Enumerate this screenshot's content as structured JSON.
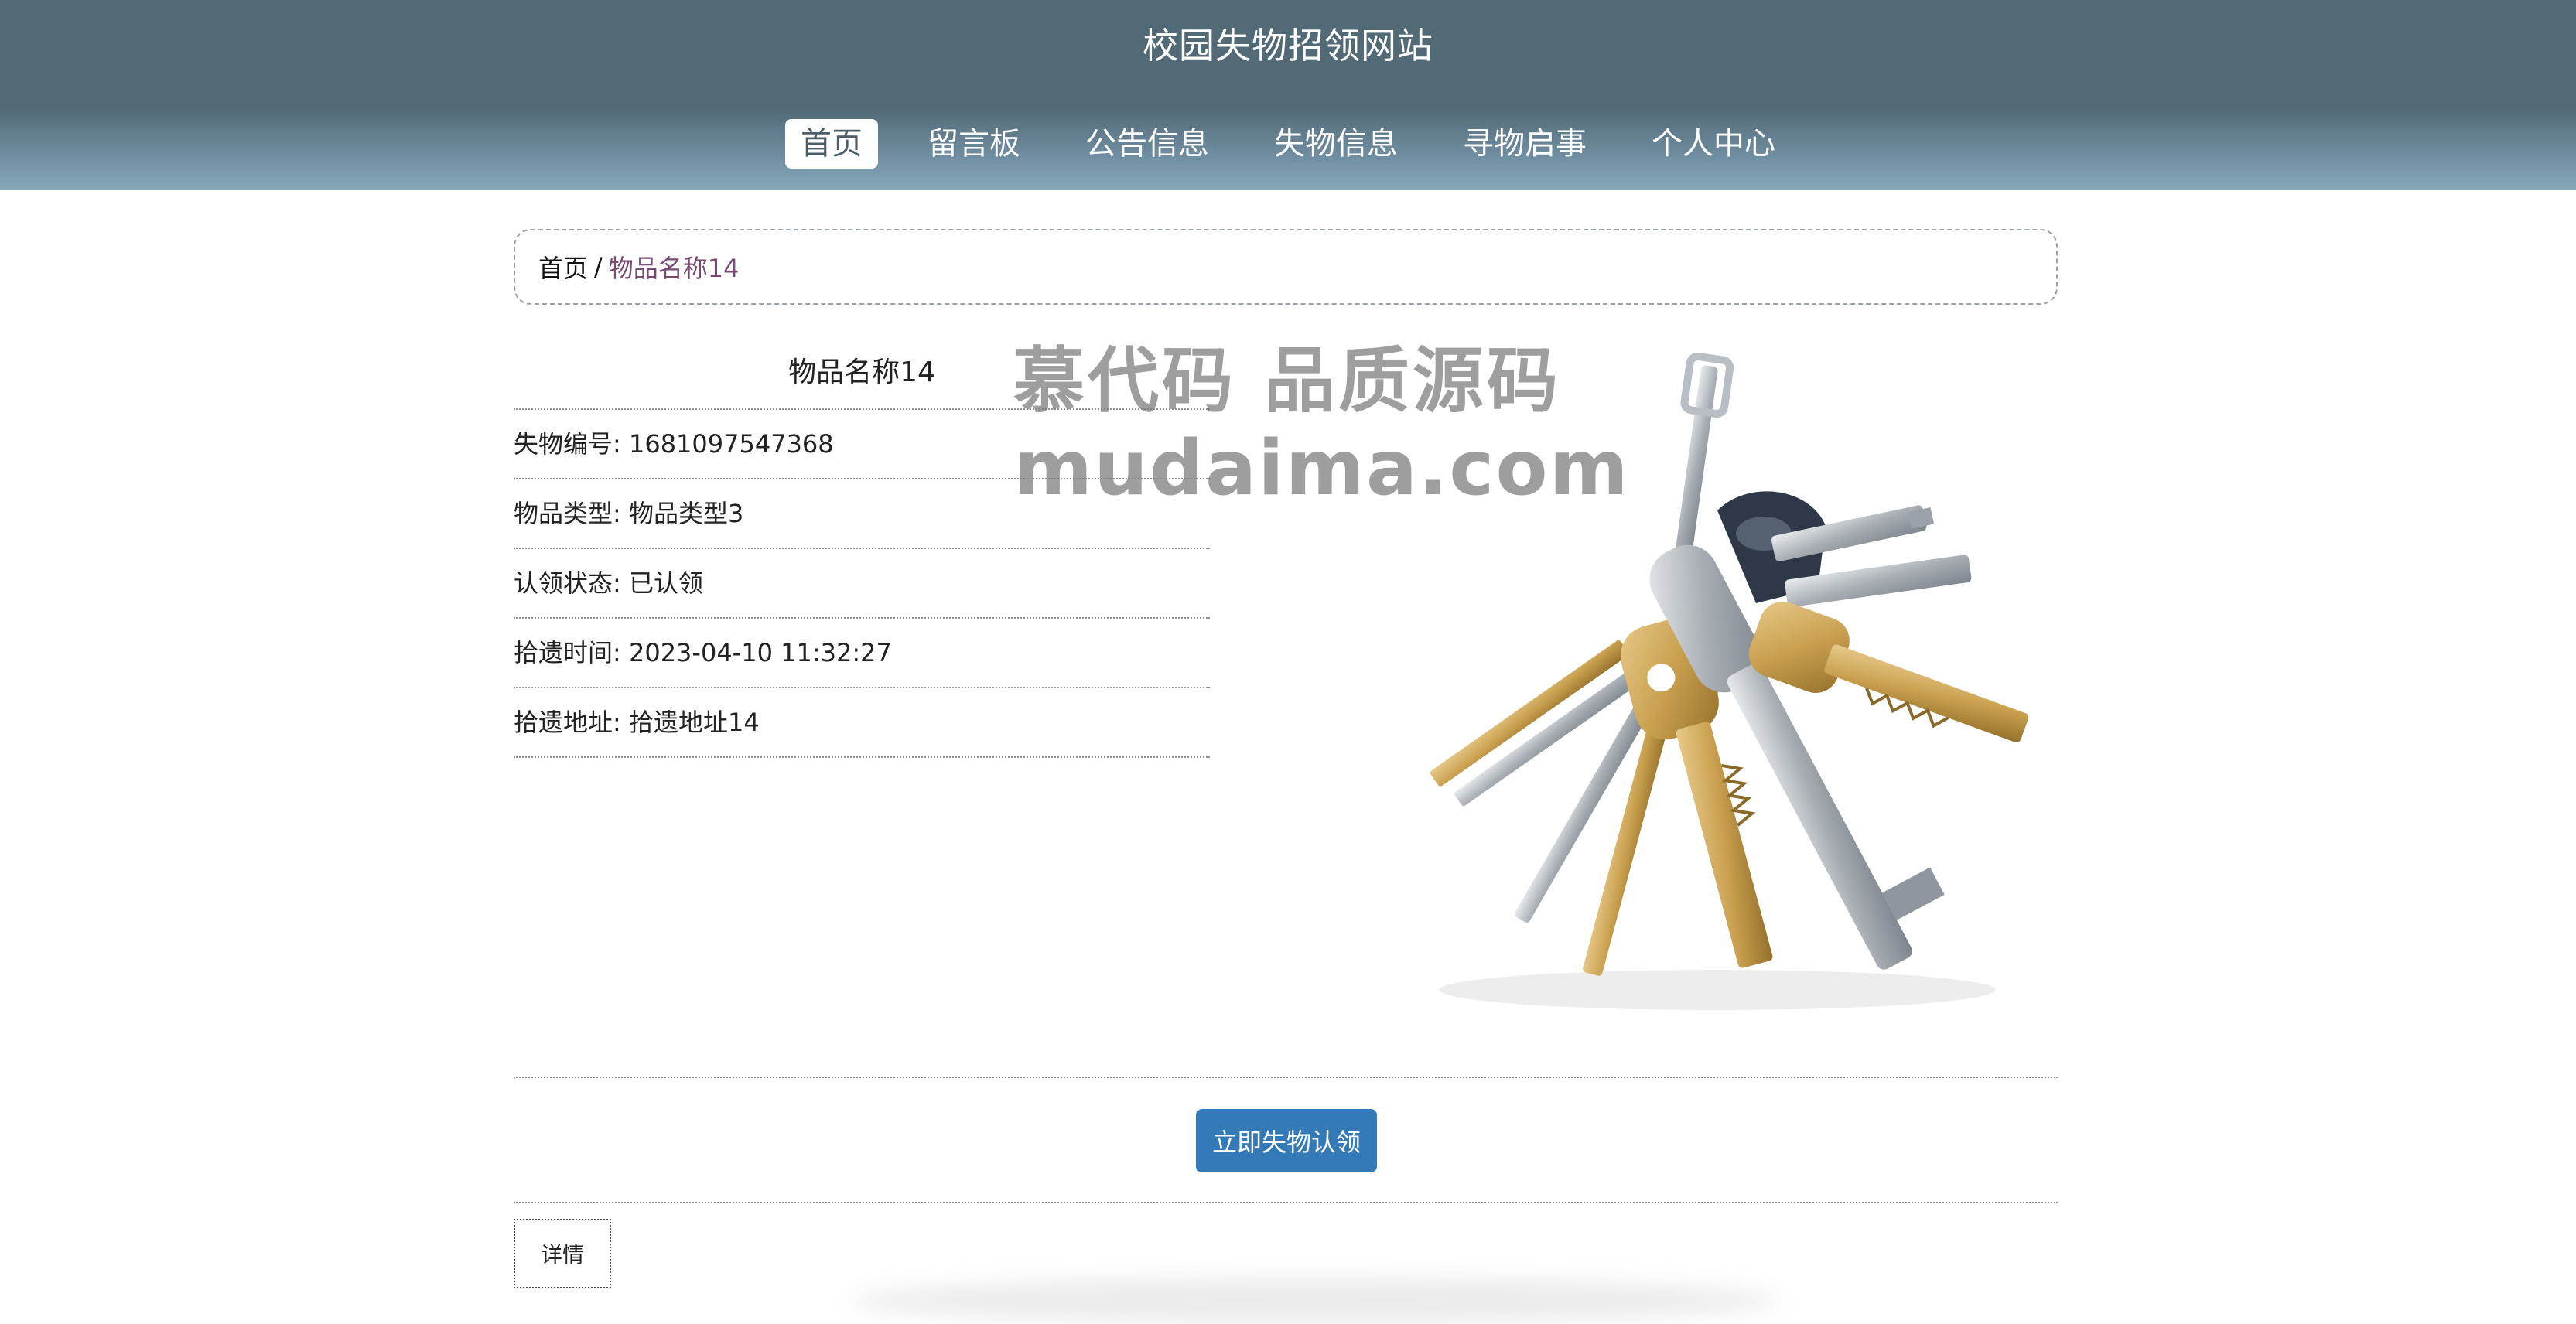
{
  "site": {
    "title": "校园失物招领网站"
  },
  "nav": {
    "items": [
      {
        "label": "首页",
        "active": true
      },
      {
        "label": "留言板"
      },
      {
        "label": "公告信息"
      },
      {
        "label": "失物信息"
      },
      {
        "label": "寻物启事"
      },
      {
        "label": "个人中心"
      }
    ]
  },
  "breadcrumb": {
    "home": "首页",
    "separator": "/",
    "current": "物品名称14"
  },
  "item": {
    "name": "物品名称14",
    "fields": [
      {
        "label": "失物编号",
        "value": "1681097547368"
      },
      {
        "label": "物品类型",
        "value": "物品类型3"
      },
      {
        "label": "认领状态",
        "value": "已认领"
      },
      {
        "label": "拾遗时间",
        "value": "2023-04-10 11:32:27"
      },
      {
        "label": "拾遗地址",
        "value": "拾遗地址14"
      }
    ]
  },
  "watermark": {
    "line1": "慕代码 品质源码",
    "line2": "mudaima.com"
  },
  "actions": {
    "claim_label": "立即失物认领"
  },
  "tabs": {
    "detail_label": "详情"
  },
  "colors": {
    "header_top": "#526a76",
    "header_bottom": "#86a7ba",
    "primary_button": "#337ab7",
    "breadcrumb_current": "#7a4a73"
  }
}
